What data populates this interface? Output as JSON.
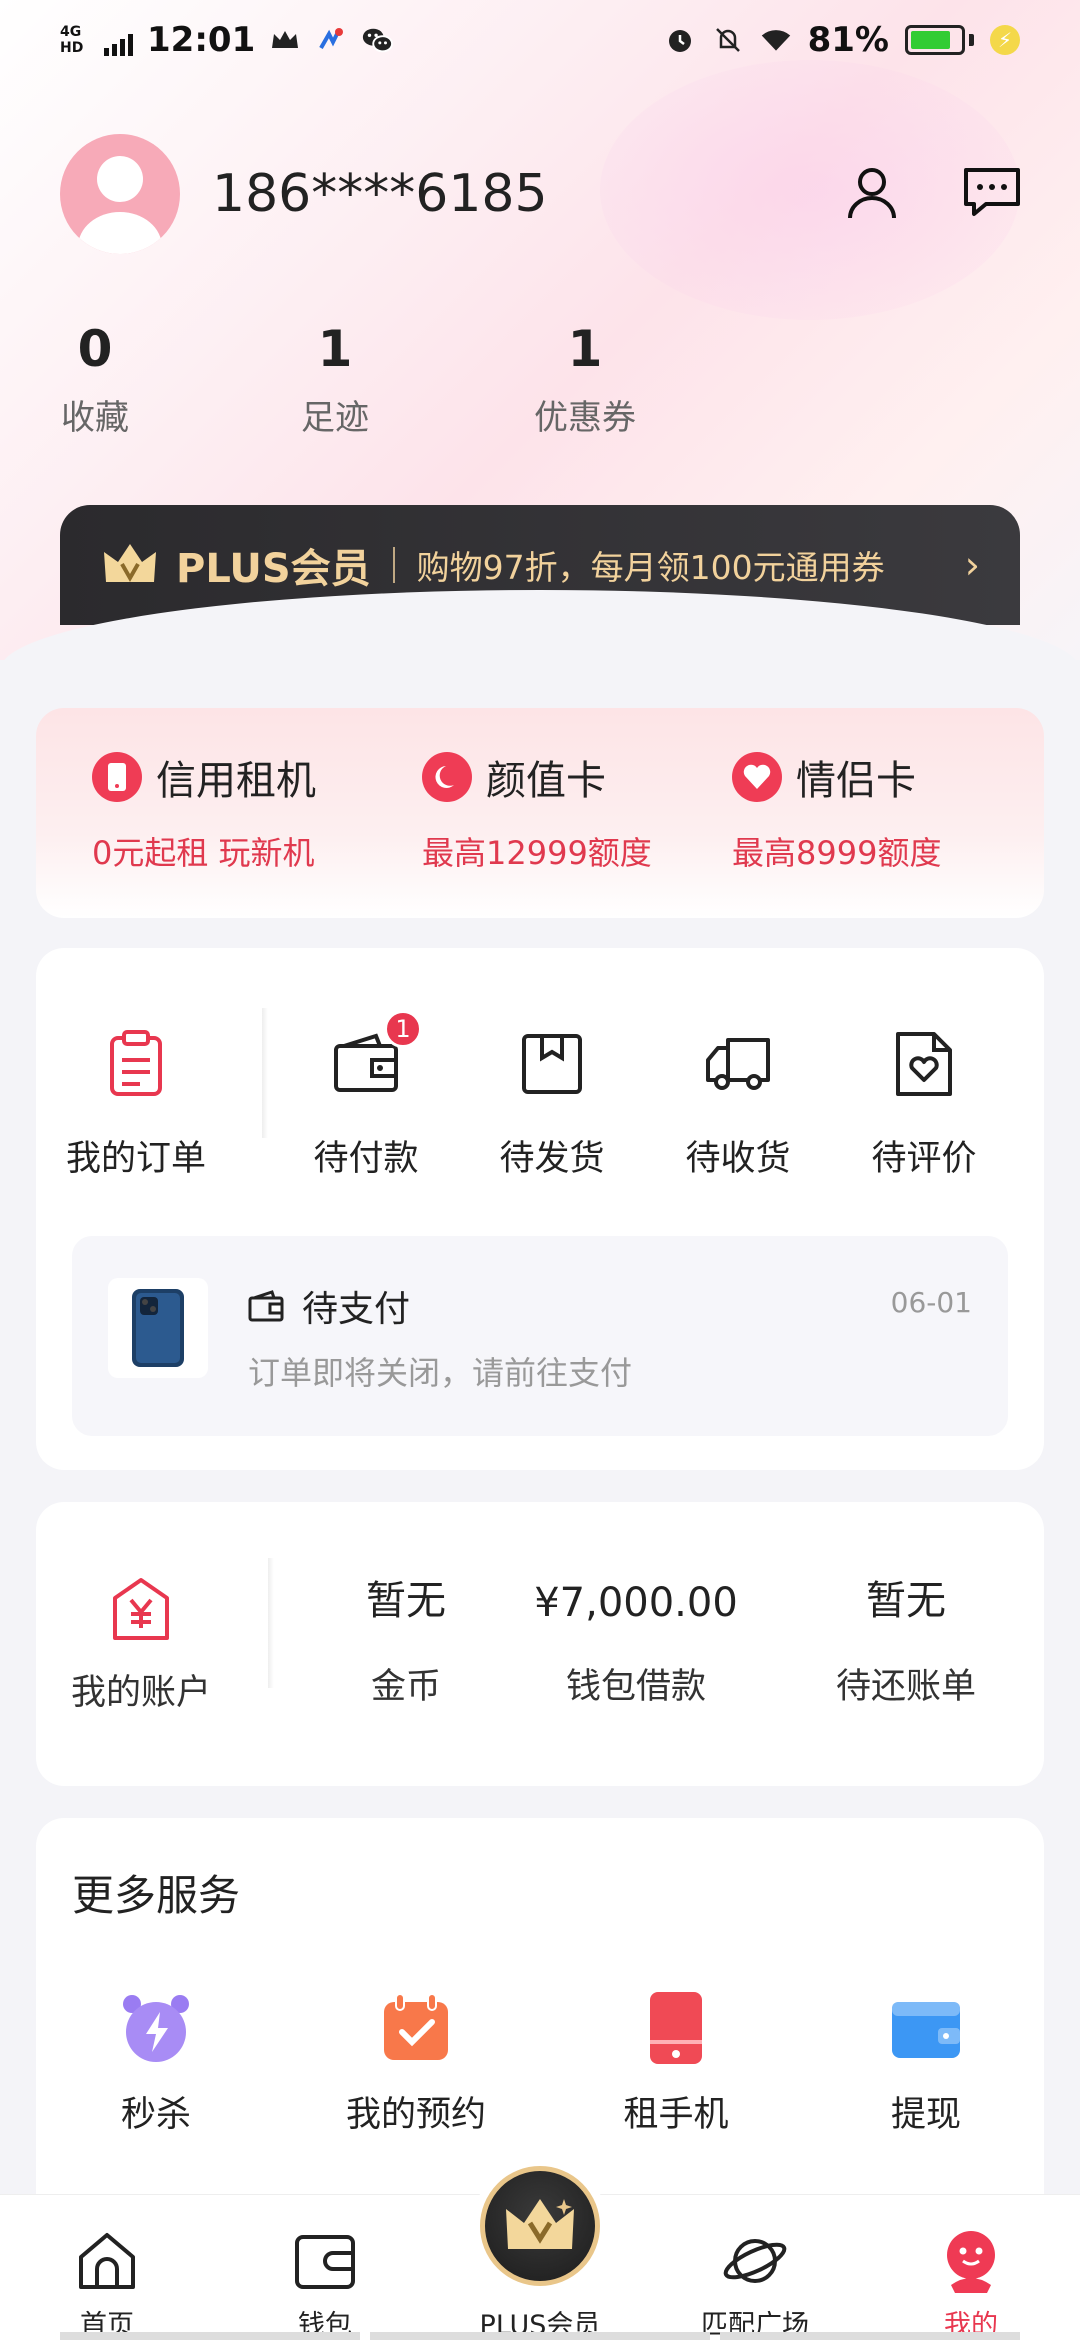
{
  "status_bar": {
    "network": "4G HD",
    "time": "12:01",
    "battery": "81%"
  },
  "profile": {
    "phone": "186****6185"
  },
  "stats": [
    {
      "num": "0",
      "label": "收藏"
    },
    {
      "num": "1",
      "label": "足迹"
    },
    {
      "num": "1",
      "label": "优惠券"
    }
  ],
  "plus_banner": {
    "title": "PLUS会员",
    "text": "购物97折，每月领100元通用券",
    "arrow": "›"
  },
  "promos": [
    {
      "title": "信用租机",
      "sub": "0元起租 玩新机"
    },
    {
      "title": "颜值卡",
      "sub": "最高12999额度"
    },
    {
      "title": "情侣卡",
      "sub": "最高8999额度"
    }
  ],
  "orders": {
    "items": [
      {
        "label": "我的订单",
        "icon": "clipboard-icon"
      },
      {
        "label": "待付款",
        "icon": "wallet-icon",
        "badge": "1"
      },
      {
        "label": "待发货",
        "icon": "box-icon"
      },
      {
        "label": "待收货",
        "icon": "truck-icon"
      },
      {
        "label": "待评价",
        "icon": "review-icon"
      }
    ],
    "pending": {
      "title": "待支付",
      "date": "06-01",
      "desc": "订单即将关闭，请前往支付"
    }
  },
  "account": {
    "items": [
      {
        "value": "",
        "label": "我的账户"
      },
      {
        "value": "暂无",
        "label": "金币"
      },
      {
        "value": "¥7,000.00",
        "label": "钱包借款"
      },
      {
        "value": "暂无",
        "label": "待还账单"
      }
    ]
  },
  "services": {
    "header": "更多服务",
    "items": [
      {
        "label": "秒杀"
      },
      {
        "label": "我的预约"
      },
      {
        "label": "租手机"
      },
      {
        "label": "提现"
      }
    ]
  },
  "tabbar": {
    "items": [
      {
        "label": "首页"
      },
      {
        "label": "钱包"
      },
      {
        "label": "PLUS会员"
      },
      {
        "label": "匹配广场"
      },
      {
        "label": "我的"
      }
    ]
  },
  "colors": {
    "accent": "#e8374f",
    "gold": "#f2d29c",
    "dark": "#2b2a2d"
  }
}
